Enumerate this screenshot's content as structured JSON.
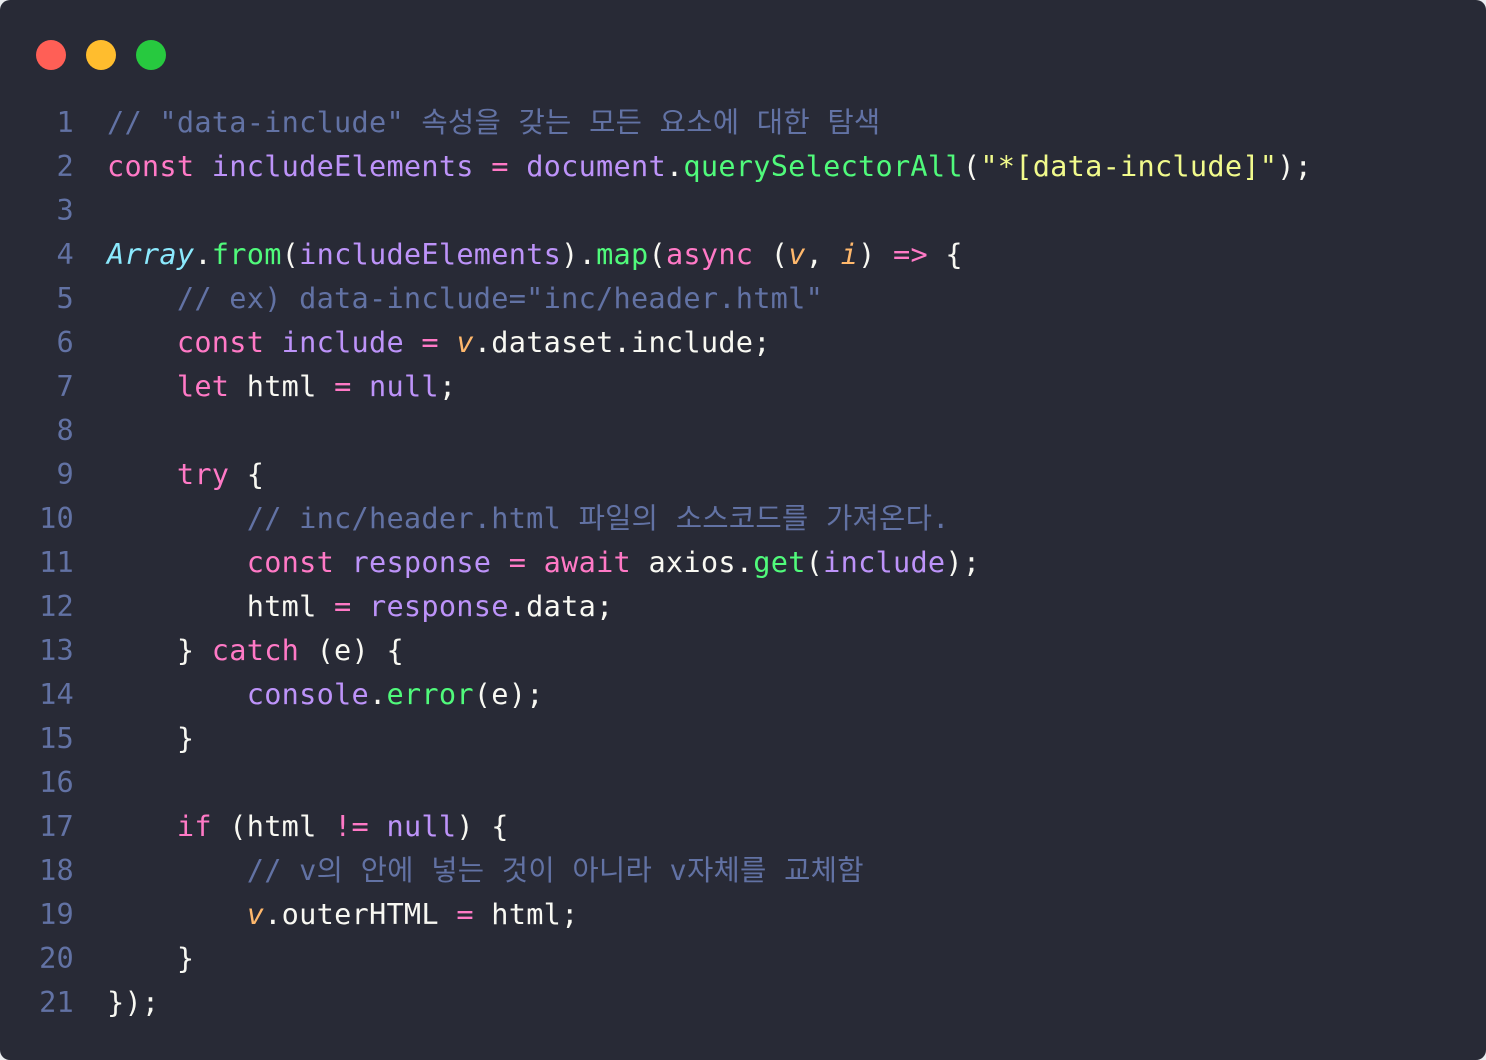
{
  "window": {
    "controls": [
      {
        "name": "close",
        "color": "#ff5f56"
      },
      {
        "name": "minimize",
        "color": "#ffbd2e"
      },
      {
        "name": "maximize",
        "color": "#27c93f"
      }
    ]
  },
  "lines": [
    {
      "n": "1",
      "tokens": [
        [
          "c",
          "// \"data-include\" 속성을 갖는 모든 요소에 대한 탐색"
        ]
      ]
    },
    {
      "n": "2",
      "tokens": [
        [
          "k",
          "const"
        ],
        [
          "p",
          " "
        ],
        [
          "v",
          "includeElements"
        ],
        [
          "p",
          " "
        ],
        [
          "o",
          "="
        ],
        [
          "p",
          " "
        ],
        [
          "v",
          "document"
        ],
        [
          "p",
          "."
        ],
        [
          "f",
          "querySelectorAll"
        ],
        [
          "p",
          "("
        ],
        [
          "s",
          "\"*[data-include]\""
        ],
        [
          "p",
          ");"
        ]
      ]
    },
    {
      "n": "3",
      "tokens": []
    },
    {
      "n": "4",
      "tokens": [
        [
          "cls",
          "Array"
        ],
        [
          "p",
          "."
        ],
        [
          "f",
          "from"
        ],
        [
          "p",
          "("
        ],
        [
          "v",
          "includeElements"
        ],
        [
          "p",
          ")."
        ],
        [
          "f",
          "map"
        ],
        [
          "p",
          "("
        ],
        [
          "k",
          "async"
        ],
        [
          "p",
          " ("
        ],
        [
          "it",
          "v"
        ],
        [
          "p",
          ", "
        ],
        [
          "it",
          "i"
        ],
        [
          "p",
          ") "
        ],
        [
          "k",
          "=>"
        ],
        [
          "p",
          " {"
        ]
      ]
    },
    {
      "n": "5",
      "tokens": [
        [
          "p",
          "    "
        ],
        [
          "c",
          "// ex) data-include=\"inc/header.html\""
        ]
      ]
    },
    {
      "n": "6",
      "tokens": [
        [
          "p",
          "    "
        ],
        [
          "k",
          "const"
        ],
        [
          "p",
          " "
        ],
        [
          "v",
          "include"
        ],
        [
          "p",
          " "
        ],
        [
          "o",
          "="
        ],
        [
          "p",
          " "
        ],
        [
          "it",
          "v"
        ],
        [
          "p",
          ".dataset.include;"
        ]
      ]
    },
    {
      "n": "7",
      "tokens": [
        [
          "p",
          "    "
        ],
        [
          "k",
          "let"
        ],
        [
          "p",
          " html "
        ],
        [
          "o",
          "="
        ],
        [
          "p",
          " "
        ],
        [
          "v",
          "null"
        ],
        [
          "p",
          ";"
        ]
      ]
    },
    {
      "n": "8",
      "tokens": []
    },
    {
      "n": "9",
      "tokens": [
        [
          "p",
          "    "
        ],
        [
          "k",
          "try"
        ],
        [
          "p",
          " {"
        ]
      ]
    },
    {
      "n": "10",
      "tokens": [
        [
          "p",
          "        "
        ],
        [
          "c",
          "// inc/header.html 파일의 소스코드를 가져온다."
        ]
      ]
    },
    {
      "n": "11",
      "tokens": [
        [
          "p",
          "        "
        ],
        [
          "k",
          "const"
        ],
        [
          "p",
          " "
        ],
        [
          "v",
          "response"
        ],
        [
          "p",
          " "
        ],
        [
          "o",
          "="
        ],
        [
          "p",
          " "
        ],
        [
          "k",
          "await"
        ],
        [
          "p",
          " axios."
        ],
        [
          "f",
          "get"
        ],
        [
          "p",
          "("
        ],
        [
          "v",
          "include"
        ],
        [
          "p",
          ");"
        ]
      ]
    },
    {
      "n": "12",
      "tokens": [
        [
          "p",
          "        html "
        ],
        [
          "o",
          "="
        ],
        [
          "p",
          " "
        ],
        [
          "v",
          "response"
        ],
        [
          "p",
          ".data;"
        ]
      ]
    },
    {
      "n": "13",
      "tokens": [
        [
          "p",
          "    } "
        ],
        [
          "k",
          "catch"
        ],
        [
          "p",
          " (e) {"
        ]
      ]
    },
    {
      "n": "14",
      "tokens": [
        [
          "p",
          "        "
        ],
        [
          "v",
          "console"
        ],
        [
          "p",
          "."
        ],
        [
          "f",
          "error"
        ],
        [
          "p",
          "(e);"
        ]
      ]
    },
    {
      "n": "15",
      "tokens": [
        [
          "p",
          "    }"
        ]
      ]
    },
    {
      "n": "16",
      "tokens": []
    },
    {
      "n": "17",
      "tokens": [
        [
          "p",
          "    "
        ],
        [
          "k",
          "if"
        ],
        [
          "p",
          " (html "
        ],
        [
          "o",
          "!="
        ],
        [
          "p",
          " "
        ],
        [
          "v",
          "null"
        ],
        [
          "p",
          ") {"
        ]
      ]
    },
    {
      "n": "18",
      "tokens": [
        [
          "p",
          "        "
        ],
        [
          "c",
          "// v의 안에 넣는 것이 아니라 v자체를 교체함"
        ]
      ]
    },
    {
      "n": "19",
      "tokens": [
        [
          "p",
          "        "
        ],
        [
          "it",
          "v"
        ],
        [
          "p",
          ".outerHTML "
        ],
        [
          "o",
          "="
        ],
        [
          "p",
          " html;"
        ]
      ]
    },
    {
      "n": "20",
      "tokens": [
        [
          "p",
          "    }"
        ]
      ]
    },
    {
      "n": "21",
      "tokens": [
        [
          "p",
          "});"
        ]
      ]
    }
  ]
}
